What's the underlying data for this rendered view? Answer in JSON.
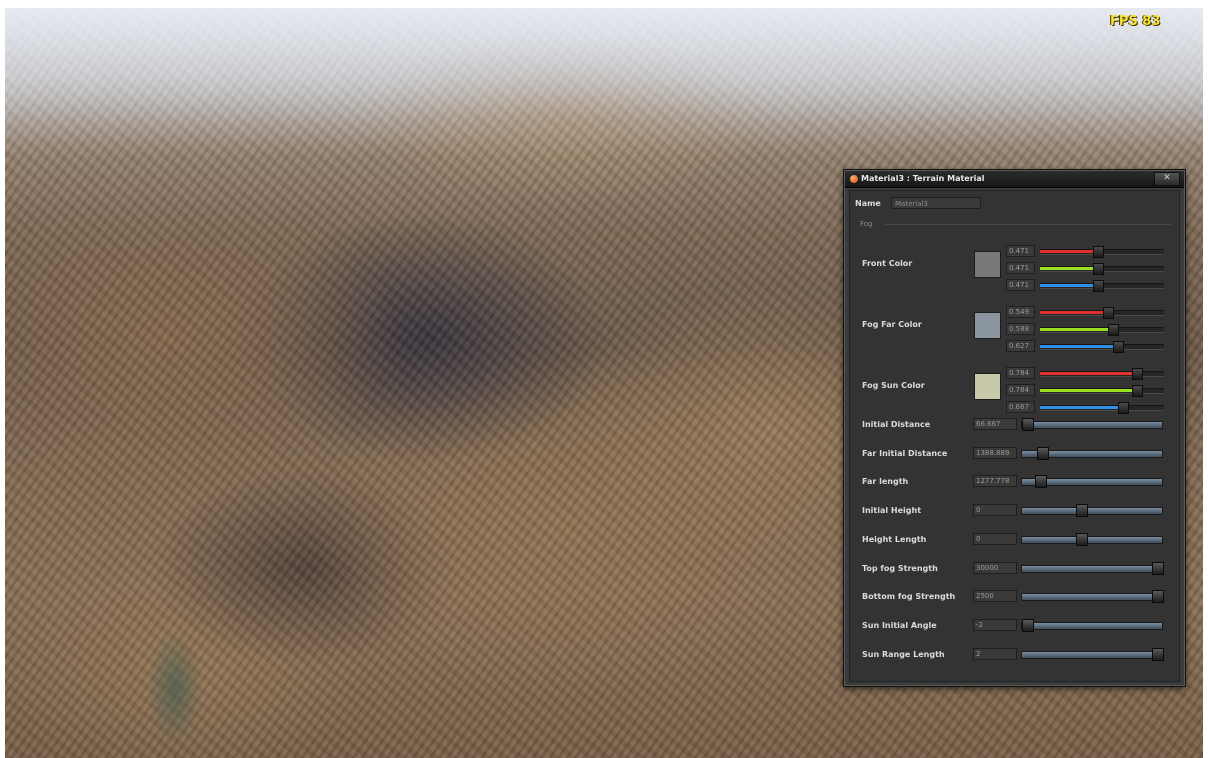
{
  "overlay": {
    "fps_text": "FPS 83"
  },
  "panel": {
    "title": "Material3 : Terrain Material",
    "close_glyph": "✕",
    "name_label": "Name",
    "name_value": "Material3",
    "fog_group_label": "Fog",
    "color_rows": [
      {
        "label": "Front Color",
        "swatch": "#787878",
        "channels": [
          {
            "value": "0.471",
            "fraction": 0.471,
            "color": "#e03030"
          },
          {
            "value": "0.471",
            "fraction": 0.471,
            "color": "#9be020"
          },
          {
            "value": "0.471",
            "fraction": 0.471,
            "color": "#2f8fe0"
          }
        ]
      },
      {
        "label": "Fog Far Color",
        "swatch": "#8c96a0",
        "channels": [
          {
            "value": "0.549",
            "fraction": 0.549,
            "color": "#e03030"
          },
          {
            "value": "0.588",
            "fraction": 0.588,
            "color": "#9be020"
          },
          {
            "value": "0.627",
            "fraction": 0.627,
            "color": "#2f8fe0"
          }
        ]
      },
      {
        "label": "Fog Sun Color",
        "swatch": "#c8c8aa",
        "channels": [
          {
            "value": "0.784",
            "fraction": 0.784,
            "color": "#e03030"
          },
          {
            "value": "0.784",
            "fraction": 0.784,
            "color": "#9be020"
          },
          {
            "value": "0.667",
            "fraction": 0.667,
            "color": "#2f8fe0"
          }
        ]
      }
    ],
    "sliders": [
      {
        "label": "Initial Distance",
        "value": "66.667",
        "fraction": 0.03
      },
      {
        "label": "Far Initial Distance",
        "value": "1388.889",
        "fraction": 0.14
      },
      {
        "label": "Far length",
        "value": "1277.778",
        "fraction": 0.13
      },
      {
        "label": "Initial Height",
        "value": "0",
        "fraction": 0.42
      },
      {
        "label": "Height Length",
        "value": "0",
        "fraction": 0.42
      },
      {
        "label": "Top fog Strength",
        "value": "30000",
        "fraction": 1.0
      },
      {
        "label": "Bottom fog Strength",
        "value": "2500",
        "fraction": 1.0
      },
      {
        "label": "Sun Initial Angle",
        "value": "-2",
        "fraction": 0.0
      },
      {
        "label": "Sun Range Length",
        "value": "2",
        "fraction": 1.0
      }
    ]
  }
}
